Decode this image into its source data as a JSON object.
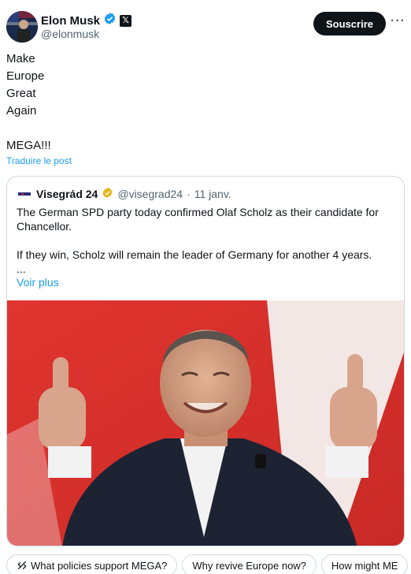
{
  "author": {
    "name": "Elon Musk",
    "handle": "@elonmusk",
    "subscribe_label": "Souscrire",
    "more_label": "···"
  },
  "post": {
    "lines": [
      "Make",
      "Europe",
      "Great",
      "Again",
      "",
      "MEGA!!!"
    ],
    "translate_label": "Traduire le post"
  },
  "quote": {
    "name": "Visegrád 24",
    "handle": "@visegrad24",
    "separator": "·",
    "date": "11 janv.",
    "text_1": "The German SPD party today confirmed Olaf Scholz as their candidate for Chancellor.",
    "text_2": "If they win, Scholz will remain the leader of Germany for another 4 years.",
    "text_3": "...",
    "more_label": "Voir plus",
    "image_icon": "photo-of-politician-thumbs-up"
  },
  "grok_chips": [
    "What policies support MEGA?",
    "Why revive Europe now?",
    "How might ME"
  ],
  "colors": {
    "accent": "#1d9bf0",
    "verified_blue": "#1d9bf0",
    "verified_gold": "#e2b719",
    "text_primary": "#0f1419",
    "text_secondary": "#536471",
    "border": "#cfd9de"
  }
}
